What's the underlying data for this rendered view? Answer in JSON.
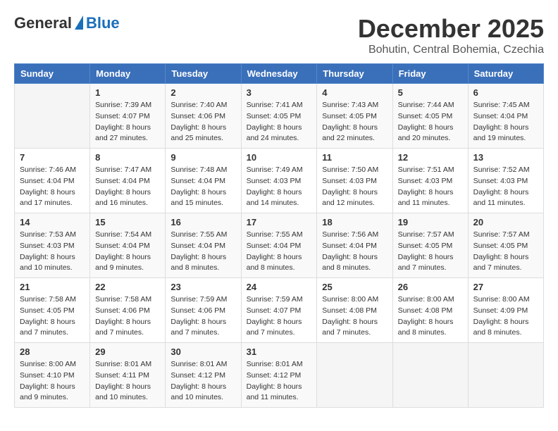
{
  "header": {
    "logo": {
      "general": "General",
      "blue": "Blue",
      "arrow": "arrow"
    },
    "title": "December 2025",
    "location": "Bohutin, Central Bohemia, Czechia"
  },
  "weekdays": [
    "Sunday",
    "Monday",
    "Tuesday",
    "Wednesday",
    "Thursday",
    "Friday",
    "Saturday"
  ],
  "weeks": [
    [
      {
        "day": "",
        "info": ""
      },
      {
        "day": "1",
        "info": "Sunrise: 7:39 AM\nSunset: 4:07 PM\nDaylight: 8 hours\nand 27 minutes."
      },
      {
        "day": "2",
        "info": "Sunrise: 7:40 AM\nSunset: 4:06 PM\nDaylight: 8 hours\nand 25 minutes."
      },
      {
        "day": "3",
        "info": "Sunrise: 7:41 AM\nSunset: 4:05 PM\nDaylight: 8 hours\nand 24 minutes."
      },
      {
        "day": "4",
        "info": "Sunrise: 7:43 AM\nSunset: 4:05 PM\nDaylight: 8 hours\nand 22 minutes."
      },
      {
        "day": "5",
        "info": "Sunrise: 7:44 AM\nSunset: 4:05 PM\nDaylight: 8 hours\nand 20 minutes."
      },
      {
        "day": "6",
        "info": "Sunrise: 7:45 AM\nSunset: 4:04 PM\nDaylight: 8 hours\nand 19 minutes."
      }
    ],
    [
      {
        "day": "7",
        "info": "Sunrise: 7:46 AM\nSunset: 4:04 PM\nDaylight: 8 hours\nand 17 minutes."
      },
      {
        "day": "8",
        "info": "Sunrise: 7:47 AM\nSunset: 4:04 PM\nDaylight: 8 hours\nand 16 minutes."
      },
      {
        "day": "9",
        "info": "Sunrise: 7:48 AM\nSunset: 4:04 PM\nDaylight: 8 hours\nand 15 minutes."
      },
      {
        "day": "10",
        "info": "Sunrise: 7:49 AM\nSunset: 4:03 PM\nDaylight: 8 hours\nand 14 minutes."
      },
      {
        "day": "11",
        "info": "Sunrise: 7:50 AM\nSunset: 4:03 PM\nDaylight: 8 hours\nand 12 minutes."
      },
      {
        "day": "12",
        "info": "Sunrise: 7:51 AM\nSunset: 4:03 PM\nDaylight: 8 hours\nand 11 minutes."
      },
      {
        "day": "13",
        "info": "Sunrise: 7:52 AM\nSunset: 4:03 PM\nDaylight: 8 hours\nand 11 minutes."
      }
    ],
    [
      {
        "day": "14",
        "info": "Sunrise: 7:53 AM\nSunset: 4:03 PM\nDaylight: 8 hours\nand 10 minutes."
      },
      {
        "day": "15",
        "info": "Sunrise: 7:54 AM\nSunset: 4:04 PM\nDaylight: 8 hours\nand 9 minutes."
      },
      {
        "day": "16",
        "info": "Sunrise: 7:55 AM\nSunset: 4:04 PM\nDaylight: 8 hours\nand 8 minutes."
      },
      {
        "day": "17",
        "info": "Sunrise: 7:55 AM\nSunset: 4:04 PM\nDaylight: 8 hours\nand 8 minutes."
      },
      {
        "day": "18",
        "info": "Sunrise: 7:56 AM\nSunset: 4:04 PM\nDaylight: 8 hours\nand 8 minutes."
      },
      {
        "day": "19",
        "info": "Sunrise: 7:57 AM\nSunset: 4:05 PM\nDaylight: 8 hours\nand 7 minutes."
      },
      {
        "day": "20",
        "info": "Sunrise: 7:57 AM\nSunset: 4:05 PM\nDaylight: 8 hours\nand 7 minutes."
      }
    ],
    [
      {
        "day": "21",
        "info": "Sunrise: 7:58 AM\nSunset: 4:05 PM\nDaylight: 8 hours\nand 7 minutes."
      },
      {
        "day": "22",
        "info": "Sunrise: 7:58 AM\nSunset: 4:06 PM\nDaylight: 8 hours\nand 7 minutes."
      },
      {
        "day": "23",
        "info": "Sunrise: 7:59 AM\nSunset: 4:06 PM\nDaylight: 8 hours\nand 7 minutes."
      },
      {
        "day": "24",
        "info": "Sunrise: 7:59 AM\nSunset: 4:07 PM\nDaylight: 8 hours\nand 7 minutes."
      },
      {
        "day": "25",
        "info": "Sunrise: 8:00 AM\nSunset: 4:08 PM\nDaylight: 8 hours\nand 7 minutes."
      },
      {
        "day": "26",
        "info": "Sunrise: 8:00 AM\nSunset: 4:08 PM\nDaylight: 8 hours\nand 8 minutes."
      },
      {
        "day": "27",
        "info": "Sunrise: 8:00 AM\nSunset: 4:09 PM\nDaylight: 8 hours\nand 8 minutes."
      }
    ],
    [
      {
        "day": "28",
        "info": "Sunrise: 8:00 AM\nSunset: 4:10 PM\nDaylight: 8 hours\nand 9 minutes."
      },
      {
        "day": "29",
        "info": "Sunrise: 8:01 AM\nSunset: 4:11 PM\nDaylight: 8 hours\nand 10 minutes."
      },
      {
        "day": "30",
        "info": "Sunrise: 8:01 AM\nSunset: 4:12 PM\nDaylight: 8 hours\nand 10 minutes."
      },
      {
        "day": "31",
        "info": "Sunrise: 8:01 AM\nSunset: 4:12 PM\nDaylight: 8 hours\nand 11 minutes."
      },
      {
        "day": "",
        "info": ""
      },
      {
        "day": "",
        "info": ""
      },
      {
        "day": "",
        "info": ""
      }
    ]
  ]
}
